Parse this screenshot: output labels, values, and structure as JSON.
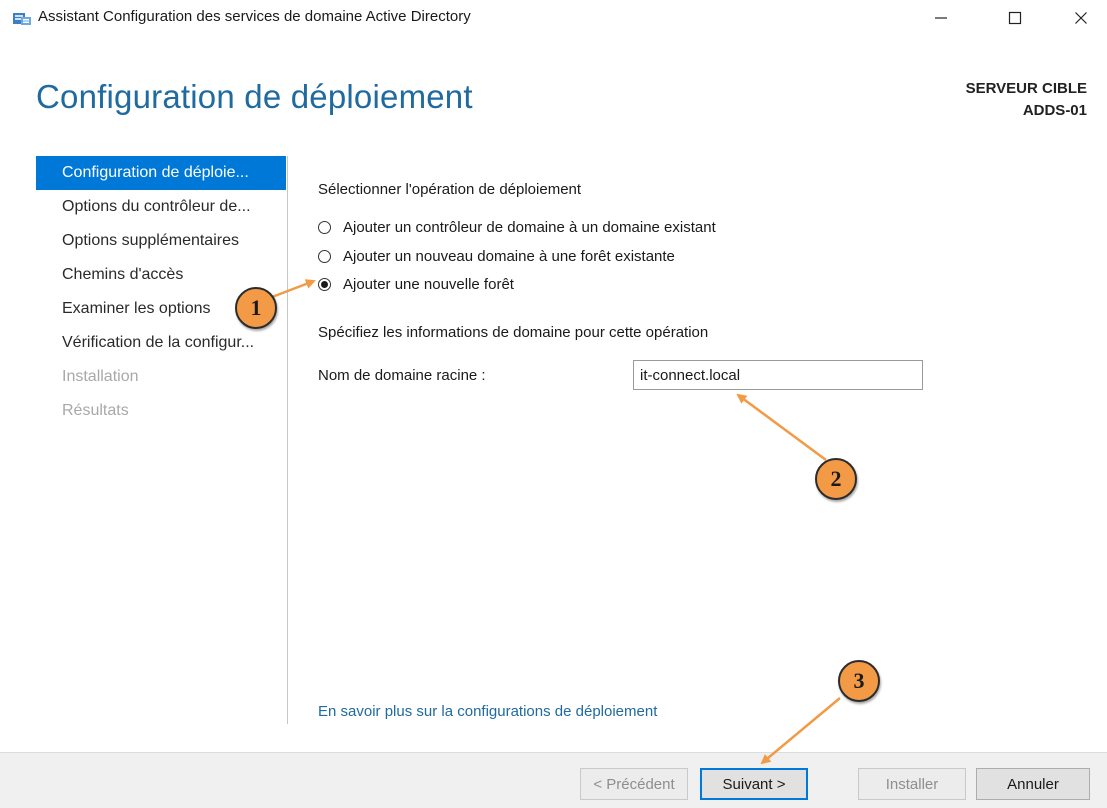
{
  "window": {
    "title": "Assistant Configuration des services de domaine Active Directory",
    "controls": {
      "minimize": "—",
      "maximize": "☐",
      "close": "✕"
    }
  },
  "page": {
    "title": "Configuration de déploiement",
    "target_label": "SERVEUR CIBLE",
    "target_server": "ADDS-01"
  },
  "sidebar": {
    "items": [
      {
        "label": "Configuration de déploie...",
        "state": "active"
      },
      {
        "label": "Options du contrôleur de...",
        "state": "enabled"
      },
      {
        "label": "Options supplémentaires",
        "state": "enabled"
      },
      {
        "label": "Chemins d'accès",
        "state": "enabled"
      },
      {
        "label": "Examiner les options",
        "state": "enabled"
      },
      {
        "label": "Vérification de la configur...",
        "state": "enabled"
      },
      {
        "label": "Installation",
        "state": "disabled"
      },
      {
        "label": "Résultats",
        "state": "disabled"
      }
    ]
  },
  "main": {
    "operation_label": "Sélectionner l'opération de déploiement",
    "options": [
      {
        "label": "Ajouter un contrôleur de domaine à un domaine existant",
        "checked": false
      },
      {
        "label": "Ajouter un nouveau domaine à une forêt existante",
        "checked": false
      },
      {
        "label": "Ajouter une nouvelle forêt",
        "checked": true
      }
    ],
    "domain_info_label": "Spécifiez les informations de domaine pour cette opération",
    "root_domain_label": "Nom de domaine racine :",
    "root_domain_value": "it-connect.local",
    "learn_more_link": "En savoir plus sur la configurations de déploiement"
  },
  "footer": {
    "previous": "< Précédent",
    "next": "Suivant >",
    "install": "Installer",
    "cancel": "Annuler"
  },
  "annotations": {
    "callouts": [
      "1",
      "2",
      "3"
    ],
    "color": "#f39a46"
  },
  "colors": {
    "accent": "#0078d7",
    "title_blue": "#1f6a9e",
    "disabled_text": "#a8a8a8",
    "footer_bg": "#f0f0f0"
  }
}
